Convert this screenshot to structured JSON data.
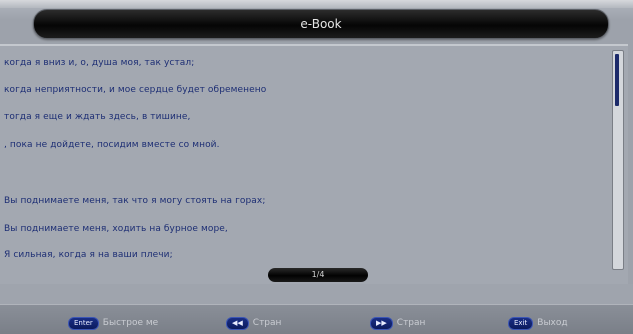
{
  "window": {
    "title": "e-Book"
  },
  "content": {
    "lines": [
      "когда я вниз и, о, душа моя, так устал;",
      "когда неприятности, и мое сердце будет обременено",
      "тогда я еще и ждать здесь, в тишине,",
      ", пока не дойдете, посидим вместе со мной.",
      "Вы поднимаете меня, так что я могу стоять на горах;",
      "Вы поднимаете меня, ходить на бурное море,",
      "Я сильная, когда я на ваши плечи;"
    ],
    "page_indicator": "1/4"
  },
  "footer": {
    "hints": [
      {
        "key": "Enter",
        "label": "Быстрое ме",
        "key_icon": "key-enter"
      },
      {
        "key": "◀◀",
        "label": "Стран",
        "key_icon": "rewind-icon"
      },
      {
        "key": "▶▶",
        "label": "Стран",
        "key_icon": "fast-forward-icon"
      },
      {
        "key": "Exit",
        "label": "Выход",
        "key_icon": "key-exit"
      }
    ]
  },
  "colors": {
    "title_bar": "#050505",
    "text": "#1d2e74",
    "background": "#a3a8b1",
    "footer_key": "#1a2f86"
  }
}
